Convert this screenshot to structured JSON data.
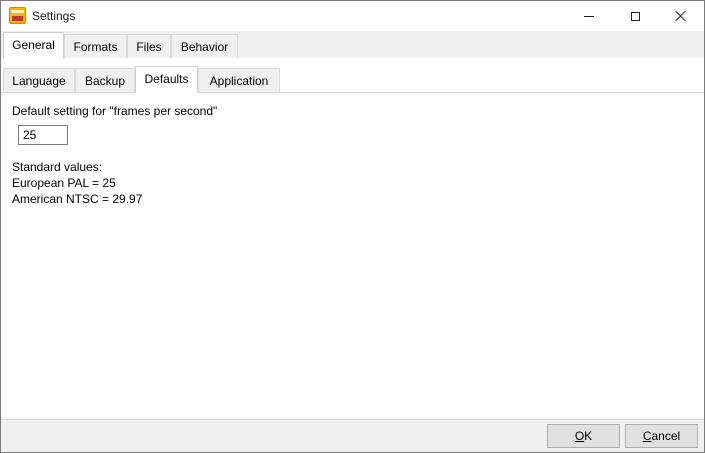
{
  "window": {
    "title": "Settings",
    "icon": "app-logo-icon"
  },
  "outer_tabs": [
    {
      "label": "General",
      "active": true
    },
    {
      "label": "Formats",
      "active": false
    },
    {
      "label": "Files",
      "active": false
    },
    {
      "label": "Behavior",
      "active": false
    }
  ],
  "inner_tabs": [
    {
      "label": "Language",
      "active": false
    },
    {
      "label": "Backup",
      "active": false
    },
    {
      "label": "Defaults",
      "active": true
    },
    {
      "label": "Application",
      "active": false
    }
  ],
  "defaults": {
    "fps_label": "Default setting for \"frames per second\"",
    "fps_value": "25",
    "standard_heading": "Standard values:",
    "pal_line": "European PAL = 25",
    "ntsc_line": "American NTSC = 29.97"
  },
  "footer": {
    "ok_mnemonic": "O",
    "ok_rest": "K",
    "cancel_mnemonic": "C",
    "cancel_rest": "ancel"
  },
  "colors": {
    "chrome": "#f0f0f0",
    "button_face": "#e1e1e1",
    "icon_brand": "#f7b500"
  }
}
